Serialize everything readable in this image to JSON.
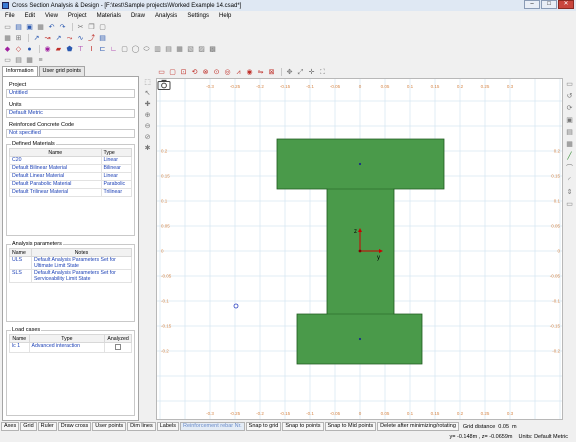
{
  "window": {
    "title": "Cross Section Analysis & Design - [F:\\test\\Sample projects\\Worked Example 14.csad*]",
    "minimize": "–",
    "maximize": "□",
    "close": "✕"
  },
  "menu": [
    "File",
    "Edit",
    "View",
    "Project",
    "Materials",
    "Draw",
    "Analysis",
    "Settings",
    "Help"
  ],
  "left_panel": {
    "tabs": [
      "Information",
      "User grid points"
    ],
    "project_label": "Project",
    "project_value": "Untitled",
    "units_label": "Units",
    "units_value": "Default Metric",
    "rc_code_label": "Reinforced Concrete Code",
    "rc_code_value": "Not specified",
    "materials": {
      "title": "Defined Materials",
      "headers": [
        "Name",
        "Type"
      ],
      "rows": [
        [
          "C20",
          "Linear"
        ],
        [
          "Default Bilinear Material",
          "Bilinear"
        ],
        [
          "Default Linear Material",
          "Linear"
        ],
        [
          "Default Parabolic Material",
          "Parabolic"
        ],
        [
          "Default Trilinear Material",
          "Trilinear"
        ]
      ]
    },
    "analysis": {
      "title": "Analysis parameters",
      "headers": [
        "Name",
        "Notes"
      ],
      "rows": [
        [
          "ULS",
          "Default Analysis Parameters Set for Ultimate Limit State"
        ],
        [
          "SLS",
          "Default Analysis Parameters Set for Serviceability Limit State"
        ]
      ]
    },
    "loadcases": {
      "title": "Load cases",
      "headers": [
        "Name",
        "Type",
        "Analyzed"
      ],
      "rows": [
        [
          "lc 1",
          "Advanced interaction",
          ""
        ]
      ]
    }
  },
  "canvas": {
    "x_ticks": [
      "-0.3",
      "-0.25",
      "-0.2",
      "-0.15",
      "-0.1",
      "-0.05",
      "0",
      "0.05",
      "0.1",
      "0.15",
      "0.2",
      "0.25",
      "0.3"
    ],
    "y_ticks": [
      "0.2",
      "0.15",
      "0.1",
      "0.05",
      "0",
      "-0.05",
      "-0.1",
      "-0.15",
      "-0.2"
    ],
    "axis_z": "z",
    "axis_y": "y",
    "colors": {
      "section_fill": "#4a9a4a",
      "section_stroke": "#1f5a1f",
      "grid": "#d6e6f2",
      "tick_label": "#d7884a",
      "axis": "#cc0000",
      "canvas_bg": "#ffffff",
      "panel_value": "#1a3fb5"
    }
  },
  "statusbar": {
    "buttons": [
      "Axes",
      "Grid",
      "Ruler",
      "Draw cross",
      "User points",
      "Dim lines",
      "Labels",
      "Reinforcement rebar Nr.",
      "Snap to grid",
      "Snap to points",
      "Snap to Mid points"
    ],
    "delete_label": "Delete after minimizing/rotating",
    "grid_distance_label": "Grid distance",
    "grid_distance_value": "0.05",
    "grid_distance_unit": "m"
  },
  "bottom": {
    "coords": "y= -0.148m , z= -0.0659m",
    "units": "Units: Default Metric"
  }
}
